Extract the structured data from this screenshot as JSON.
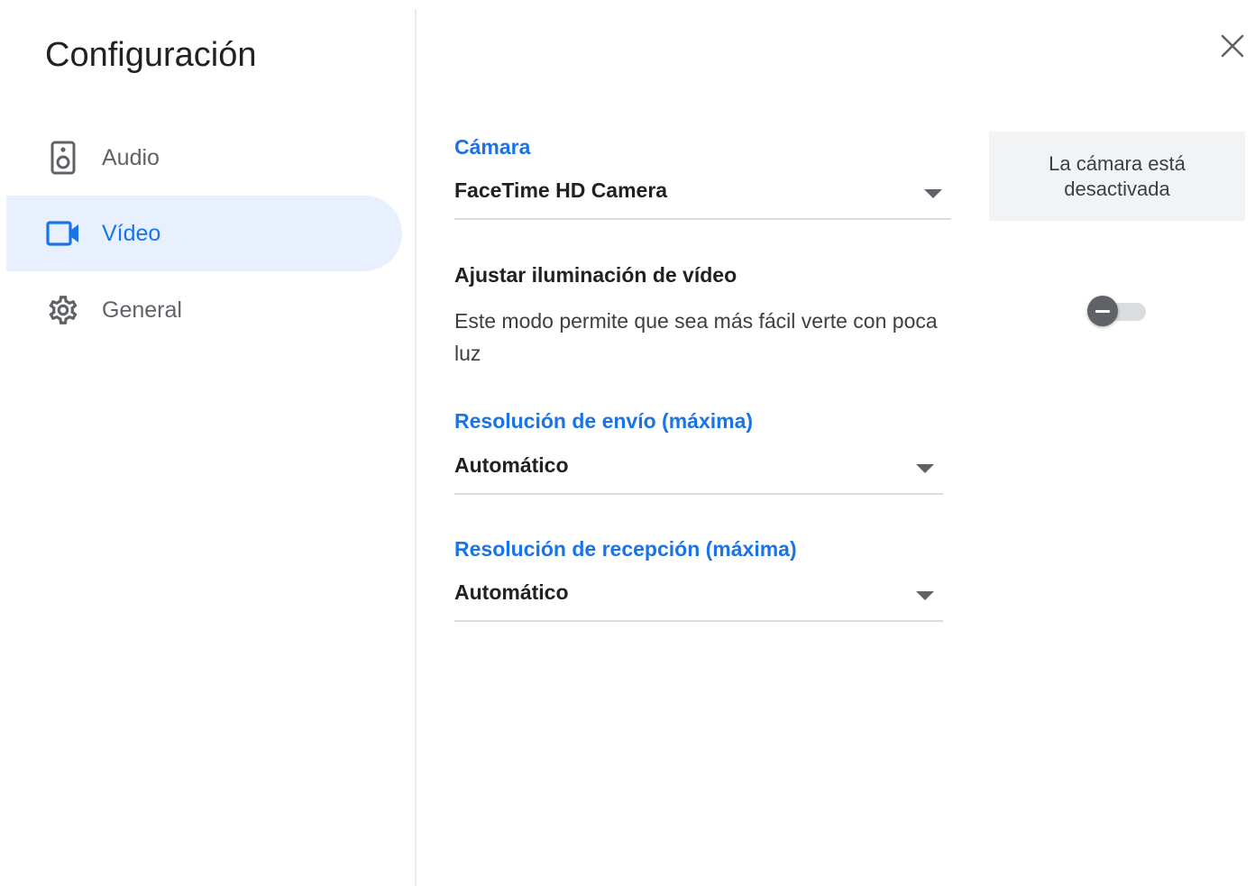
{
  "dialog": {
    "title": "Configuración",
    "close_icon": "close-icon"
  },
  "sidebar": {
    "items": [
      {
        "label": "Audio",
        "icon": "speaker-icon",
        "selected": false
      },
      {
        "label": "Vídeo",
        "icon": "videocam-icon",
        "selected": true
      },
      {
        "label": "General",
        "icon": "gear-icon",
        "selected": false
      }
    ]
  },
  "video": {
    "camera": {
      "label": "Cámara",
      "value": "FaceTime HD Camera"
    },
    "lighting": {
      "heading": "Ajustar iluminación de vídeo",
      "description": "Este modo permite que sea más fácil verte con poca luz",
      "enabled": false
    },
    "send_resolution": {
      "label": "Resolución de envío (máxima)",
      "value": "Automático"
    },
    "receive_resolution": {
      "label": "Resolución de recepción (máxima)",
      "value": "Automático"
    },
    "preview": {
      "text": "La cámara está desactivada"
    }
  },
  "colors": {
    "accent": "#1a73e8",
    "selected_bg": "#e8f0fe",
    "text_primary": "#202124",
    "text_secondary": "#5f6368",
    "divider": "#e8eaed",
    "preview_bg": "#f1f3f4"
  }
}
